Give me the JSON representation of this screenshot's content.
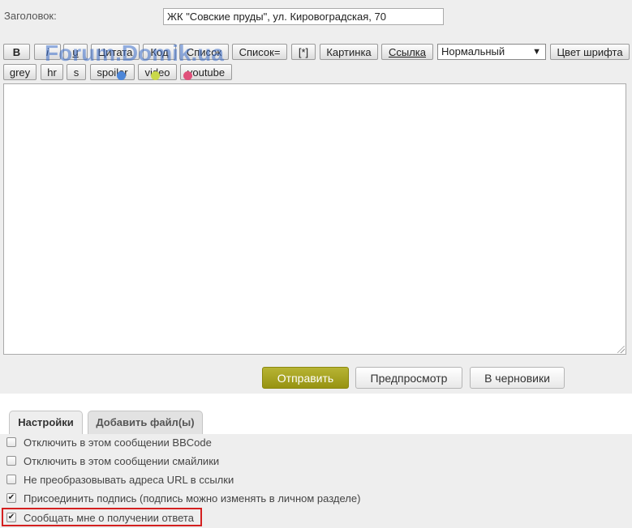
{
  "form": {
    "subject_label": "Заголовок:",
    "subject_value": "ЖК \"Совские пруды\", ул. Кировоградская, 70"
  },
  "watermark": "Forum.Domik.ua",
  "toolbar": {
    "row1": [
      "B",
      "i",
      "u",
      "Цитата",
      "Код",
      "Список",
      "Список=",
      "[*]",
      "Картинка",
      "Ссылка"
    ],
    "font_size_select": "Нормальный",
    "font_color_button": "Цвет шрифта",
    "row2": [
      "grey",
      "hr",
      "s",
      "spoiler",
      "video",
      "youtube"
    ]
  },
  "editor": {
    "value": ""
  },
  "actions": {
    "submit": "Отправить",
    "preview": "Предпросмотр",
    "draft": "В черновики"
  },
  "tabs": {
    "settings": "Настройки",
    "attach": "Добавить файл(ы)"
  },
  "options": [
    {
      "label": "Отключить в этом сообщении BBCode",
      "checked": false
    },
    {
      "label": "Отключить в этом сообщении смайлики",
      "checked": false
    },
    {
      "label": "Не преобразовывать адреса URL в ссылки",
      "checked": false
    },
    {
      "label": "Присоединить подпись (подпись можно изменять в личном разделе)",
      "checked": true
    },
    {
      "label": "Сообщать мне о получении ответа",
      "checked": true
    }
  ],
  "colors": {
    "submit_button": "#a6a21f",
    "highlight": "#d42020",
    "watermark": "#3c6ec8"
  }
}
